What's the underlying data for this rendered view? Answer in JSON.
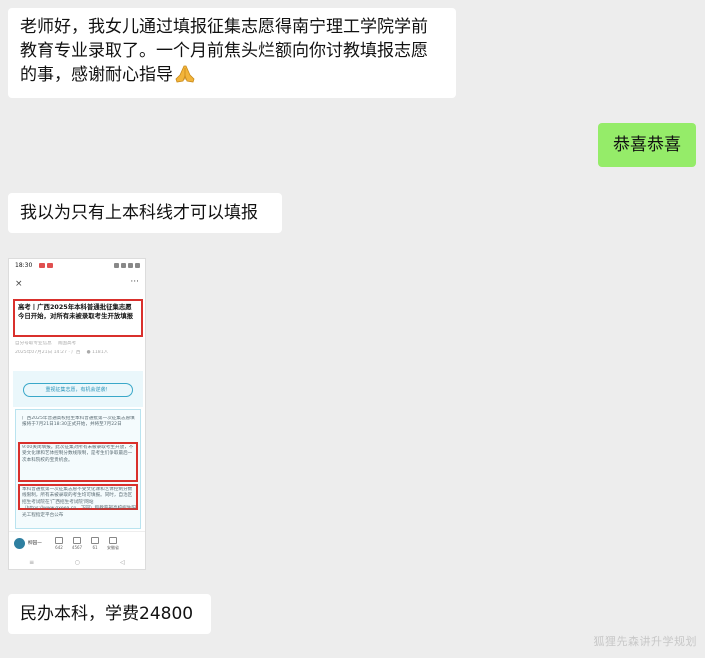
{
  "messages": [
    {
      "side": "left",
      "text": "老师好，我女儿通过填报征集志愿得南宁理工学院学前教育专业录取了。一个月前焦头烂额向你讨教填报志愿的事，感谢耐心指导"
    },
    {
      "side": "right",
      "text": "恭喜恭喜"
    },
    {
      "side": "left",
      "text": "我以为只有上本科线才可以填报"
    },
    {
      "side": "left",
      "text": "民办本科，学费24800"
    }
  ],
  "icons": {
    "prayer": "pray-hands-icon"
  },
  "phone": {
    "status_time": "18:30",
    "title": "高考丨广西2025年本科普通批征集志愿今日开始，对所有未被录取考生开放填报",
    "meta_line1": "自分号取专业信息 　南国高考",
    "meta_line2": "2025年07月21日 14:27 · 广西 　● 1181人",
    "banner_text": "重视征集志愿，有机会逆袭！",
    "para1": "广西2025年普通高校招生本科普通批第一次征集志愿填报将于7月21日18:30正式开始，并将至7月22日",
    "para2": "9:00关闭填报。此次征集对所有未被录取考生开放，不受文化课和艺体控制分数线限制，是考生们争取最后一次本科院校的宝贵机会。",
    "para3": "本科普通批第一次征集志愿不受文化课和艺体控制分数线限制，所有未被录取的考生均可填报。同时，自治区招生考试院在'广西招生考试院'网站（https://www.gxeea.cn，下同）和教育部高校招生阳光工程指定平台公布",
    "account": "柳园一",
    "actions": [
      {
        "icon": "like-icon",
        "count": "642"
      },
      {
        "icon": "share-icon",
        "count": "4567"
      },
      {
        "icon": "star-icon",
        "count": "61"
      },
      {
        "icon": "wow-icon",
        "count": "安徽省"
      }
    ],
    "sys_nav": [
      "≡",
      "○",
      "◁"
    ]
  },
  "watermark": "狐狸先森讲升学规划",
  "colors": {
    "background": "#ededed",
    "incoming": "#ffffff",
    "outgoing": "#95ec69",
    "highlight": "#d9302c"
  }
}
